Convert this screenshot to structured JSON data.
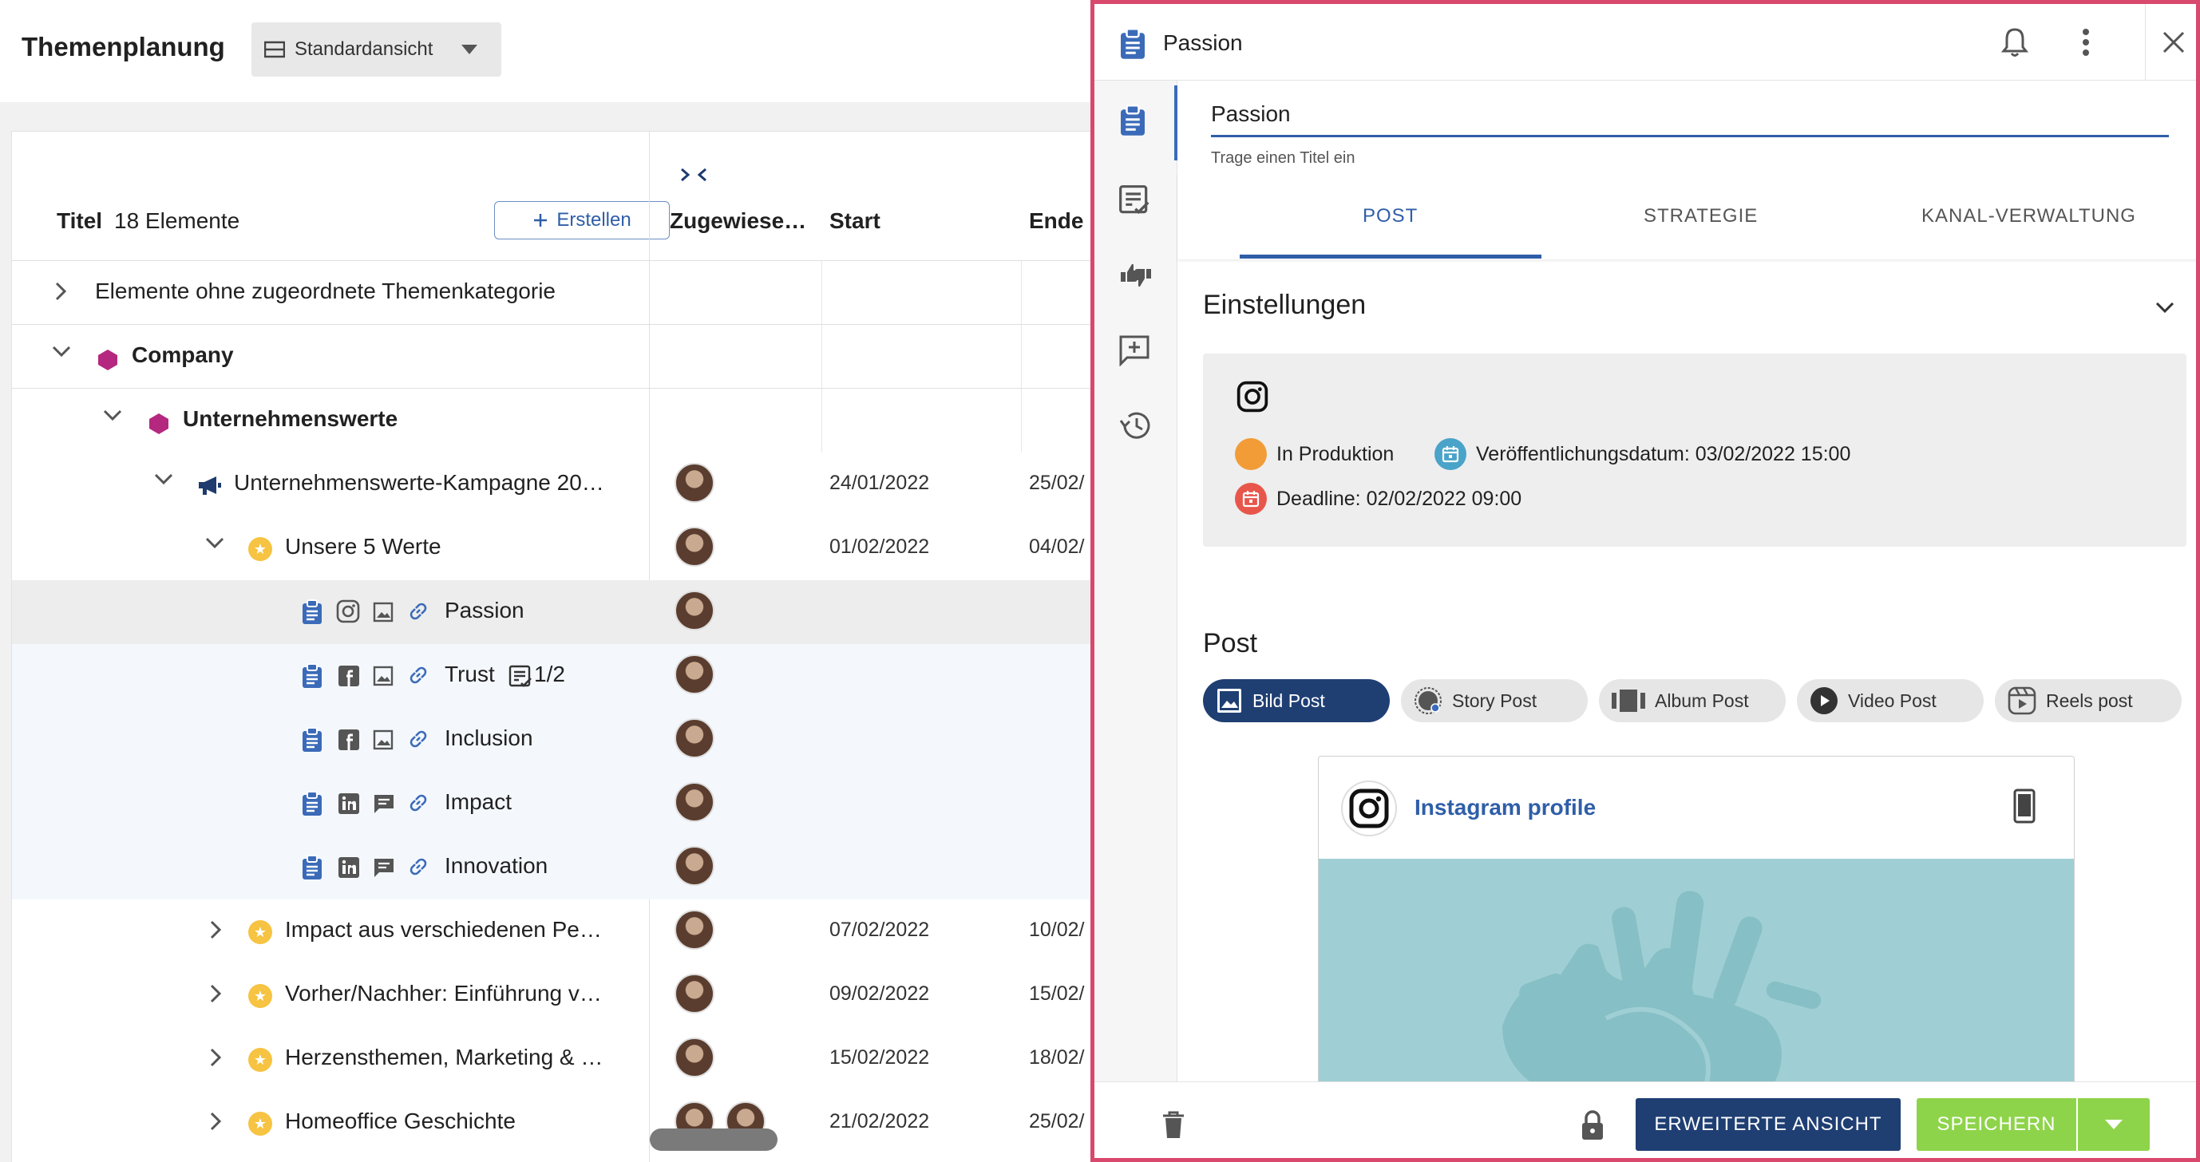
{
  "app": {
    "title": "Themenplanung",
    "view_select": "Standardansicht"
  },
  "table": {
    "col_title": "Titel",
    "count": "18 Elemente",
    "create_label": "Erstellen",
    "col_assigned": "Zugewiese…",
    "col_start": "Start",
    "col_end": "Ende",
    "rows": [
      {
        "title": "Elemente ohne zugeordnete Themenkategorie",
        "start": "",
        "end": ""
      },
      {
        "title": "Company",
        "start": "",
        "end": ""
      },
      {
        "title": "Unternehmenswerte",
        "start": "",
        "end": ""
      },
      {
        "title": "Unternehmenswerte-Kampagne 20…",
        "start": "24/01/2022",
        "end": "25/02/"
      },
      {
        "title": "Unsere 5 Werte",
        "start": "01/02/2022",
        "end": "04/02/"
      },
      {
        "title": "Passion",
        "start": "",
        "end": ""
      },
      {
        "title": "Trust",
        "extra": "1/2",
        "start": "",
        "end": ""
      },
      {
        "title": "Inclusion",
        "start": "",
        "end": ""
      },
      {
        "title": "Impact",
        "start": "",
        "end": ""
      },
      {
        "title": "Innovation",
        "start": "",
        "end": ""
      },
      {
        "title": "Impact aus verschiedenen Pe…",
        "start": "07/02/2022",
        "end": "10/02/"
      },
      {
        "title": "Vorher/Nachher: Einführung v…",
        "start": "09/02/2022",
        "end": "15/02/"
      },
      {
        "title": "Herzensthemen, Marketing & …",
        "start": "15/02/2022",
        "end": "18/02/"
      },
      {
        "title": "Homeoffice Geschichte",
        "start": "21/02/2022",
        "end": "25/02/"
      }
    ]
  },
  "detail": {
    "title": "Passion",
    "input_value": "Passion",
    "input_hint": "Trage einen Titel ein",
    "tabs": [
      "POST",
      "STRATEGIE",
      "KANAL-VERWALTUNG"
    ],
    "settings_title": "Einstellungen",
    "status": "In Produktion",
    "publish": "Veröffentlichungsdatum: 03/02/2022 15:00",
    "deadline": "Deadline: 02/02/2022 09:00",
    "post_title": "Post",
    "post_types": [
      "Bild Post",
      "Story Post",
      "Album Post",
      "Video Post",
      "Reels post"
    ],
    "preview_profile": "Instagram profile",
    "btn_advanced": "ERWEITERTE ANSICHT",
    "btn_save": "SPEICHERN"
  },
  "colors": {
    "accent": "#2f5ea8",
    "navy": "#1f3f73",
    "save": "#8ed44a",
    "border": "#d9486d",
    "category": "#b5287f"
  }
}
